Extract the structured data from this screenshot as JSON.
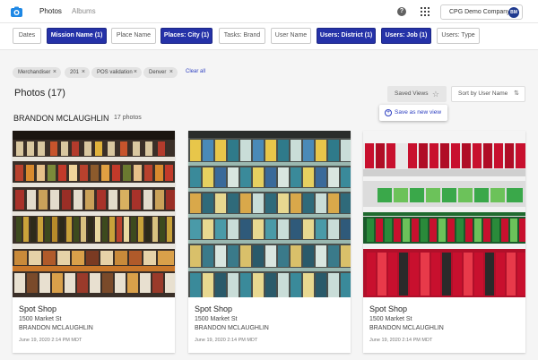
{
  "nav": {
    "tabs": [
      {
        "label": "Photos"
      },
      {
        "label": "Albums"
      }
    ],
    "help": "?",
    "company": "CPG Demo Company",
    "avatar": "BM"
  },
  "filters": [
    {
      "label": "Dates",
      "active": false
    },
    {
      "label": "Mission Name (1)",
      "active": true
    },
    {
      "label": "Place Name",
      "active": false
    },
    {
      "label": "Places: City (1)",
      "active": true
    },
    {
      "label": "Tasks: Brand",
      "active": false
    },
    {
      "label": "User Name",
      "active": false
    },
    {
      "label": "Users: District (1)",
      "active": true
    },
    {
      "label": "Users: Job (1)",
      "active": true
    },
    {
      "label": "Users: Type",
      "active": false
    }
  ],
  "tags": [
    "Merchandiser",
    "201",
    "POS validation",
    "Denver"
  ],
  "clear_all": "Clear all",
  "page_title": "Photos (17)",
  "saved_views": "Saved Views",
  "sort_by": "Sort by User Name",
  "save_as_new_view": "Save as new view",
  "group": {
    "user": "BRANDON MCLAUGHLIN",
    "count": "17 photos"
  },
  "cards": [
    {
      "shop": "Spot Shop",
      "address": "1500 Market St",
      "user": "BRANDON MCLAUGHLIN",
      "date": "June 19, 2020 2:14 PM MDT"
    },
    {
      "shop": "Spot Shop",
      "address": "1500 Market St",
      "user": "BRANDON MCLAUGHLIN",
      "date": "June 19, 2020 2:14 PM MDT"
    },
    {
      "shop": "Spot Shop",
      "address": "1500 Market St",
      "user": "BRANDON MCLAUGHLIN",
      "date": "June 19, 2020 2:14 PM MDT"
    }
  ],
  "colors": {
    "accent": "#2532a8",
    "link": "#2c3ec0",
    "logo": "#1e88e5"
  },
  "icons": [
    "camera-logo-icon",
    "help-icon",
    "apps-grid-icon",
    "close-icon",
    "star-icon",
    "sort-icon",
    "plus-circle-icon"
  ]
}
